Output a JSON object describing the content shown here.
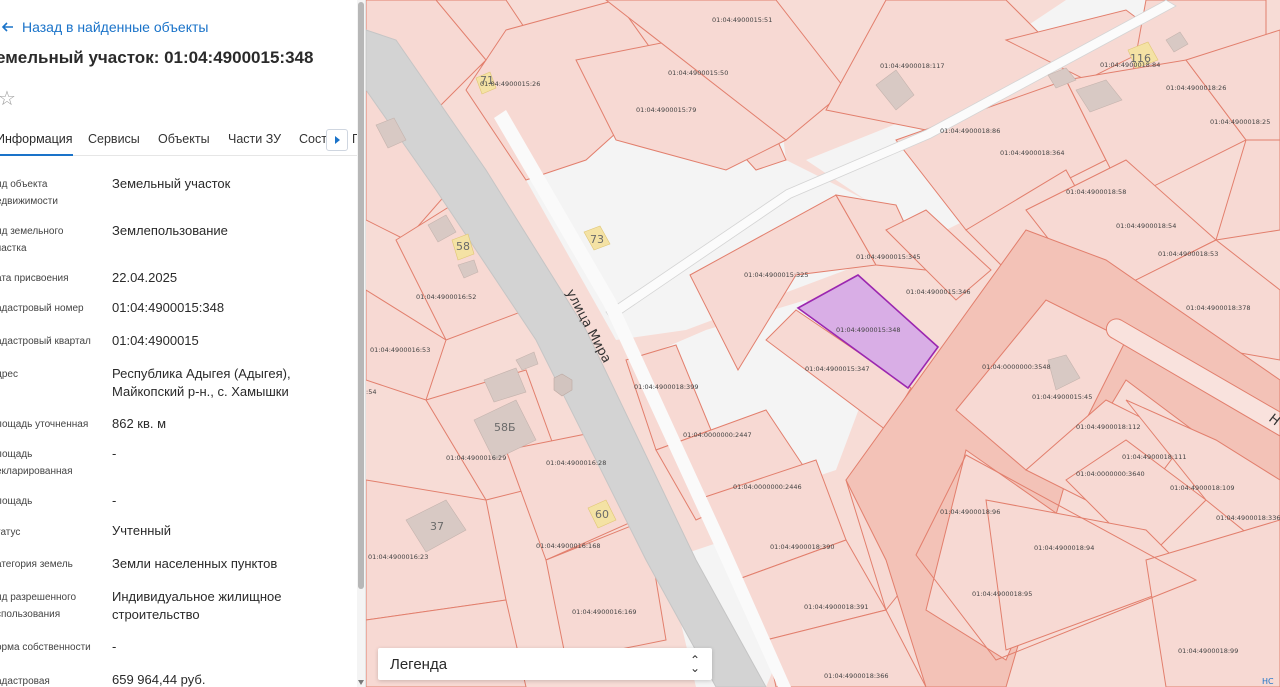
{
  "panel": {
    "back_label": "Назад в найденные объекты",
    "title": "емельный участок: 01:04:4900015:348",
    "tabs": [
      {
        "label": "Информация",
        "active": true
      },
      {
        "label": "Сервисы"
      },
      {
        "label": "Объекты"
      },
      {
        "label": "Части ЗУ"
      },
      {
        "label": "Соста"
      },
      {
        "label": "Г"
      }
    ],
    "fields": [
      {
        "label": "ид объекта\nедвижимости",
        "value": "Земельный участок"
      },
      {
        "label": "ид земельного\nчастка",
        "value": "Землепользование"
      },
      {
        "label": "ата присвоения",
        "value": "22.04.2025"
      },
      {
        "label": "адастровый номер",
        "value": "01:04:4900015:348"
      },
      {
        "label": "адастровый квартал",
        "value": "01:04:4900015"
      },
      {
        "label": "дрес",
        "value": "Республика Адыгея (Адыгея),\nМайкопский р-н., с. Хамышки"
      },
      {
        "label": "лощадь уточненная",
        "value": "862 кв. м"
      },
      {
        "label": "лощадь\nекларированная",
        "value": "-"
      },
      {
        "label": "лощадь",
        "value": "-"
      },
      {
        "label": "татус",
        "value": "Учтенный"
      },
      {
        "label": "атегория земель",
        "value": "Земли населенных пунктов"
      },
      {
        "label": "ид разрешенного\nспользования",
        "value": "Индивидуальное жилищное\nстроительство"
      },
      {
        "label": "орма собственности",
        "value": "-"
      },
      {
        "label": "адастровая",
        "value": "659 964,44 руб."
      }
    ]
  },
  "map": {
    "street_label": "улица Мира",
    "legend_label": "Легенда",
    "highlight_color": "#d9aee6",
    "highlight_stroke": "#9b27b0",
    "plot_labels": [
      "01:04:4900015:51",
      "01:04:4900015:50",
      "01:04:4900015:79",
      "01:04:4900015:26",
      "01:04:4900018:117",
      "01:04:4900018:84",
      "01:04:4900018:26",
      "01:04:4900018:86",
      "01:04:4900018:25",
      "01:04:4900018:364",
      "01:04:4900018:58",
      "01:04:4900018:54",
      "01:04:4900018:53",
      "01:04:4900018:378",
      "01:04:4900015:325",
      "01:04:4900015:345",
      "01:04:4900015:346",
      "01:04:4900015:348",
      "01:04:4900015:347",
      "01:04:4900016:52",
      "01:04:4900016:53",
      "01:04:4900018:399",
      "01:04:0000000:2447",
      "01:04:0000000:2446",
      "01:04:4900018:390",
      "01:04:4900018:391",
      "01:04:4900018:366",
      "01:04:4900016:29",
      "01:04:4900016:28",
      "01:04:4900016:168",
      "01:04:4900016:169",
      "01:04:4900016:23",
      "01:04:0000000:3548",
      "01:04:4900015:45",
      "01:04:4900018:112",
      "01:04:4900018:111",
      "01:04:0000000:3640",
      "01:04:4900018:109",
      "01:04:4900018:336",
      "01:04:4900018:96",
      "01:04:4900018:94",
      "01:04:4900018:95",
      "01:04:4900018:99"
    ],
    "house_numbers": [
      "71",
      "73",
      "58",
      "58Б",
      "37",
      "60",
      "116"
    ],
    "edge_labels": [
      "Н",
      "НС",
      ":54"
    ]
  }
}
